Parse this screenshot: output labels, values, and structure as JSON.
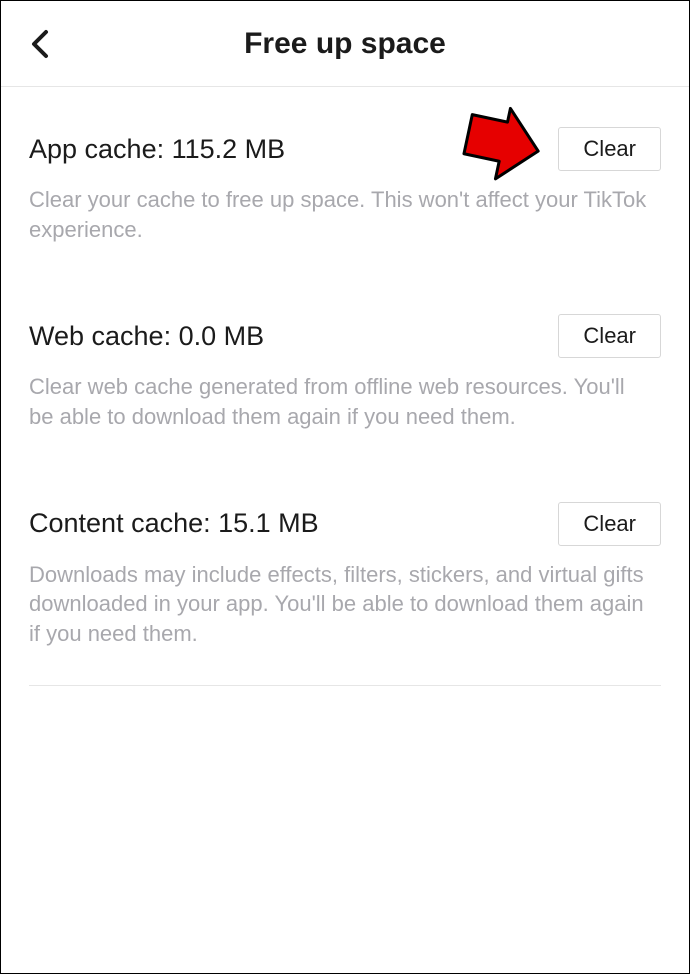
{
  "header": {
    "title": "Free up space"
  },
  "sections": [
    {
      "title": "App cache: 115.2 MB",
      "description": "Clear your cache to free up space. This won't affect your TikTok experience.",
      "button": "Clear"
    },
    {
      "title": "Web cache: 0.0 MB",
      "description": "Clear web cache generated from offline web resources. You'll be able to download them again if you need them.",
      "button": "Clear"
    },
    {
      "title": "Content cache: 15.1 MB",
      "description": "Downloads may include effects, filters, stickers, and virtual gifts downloaded in your app. You'll be able to download them again if you need them.",
      "button": "Clear"
    }
  ]
}
